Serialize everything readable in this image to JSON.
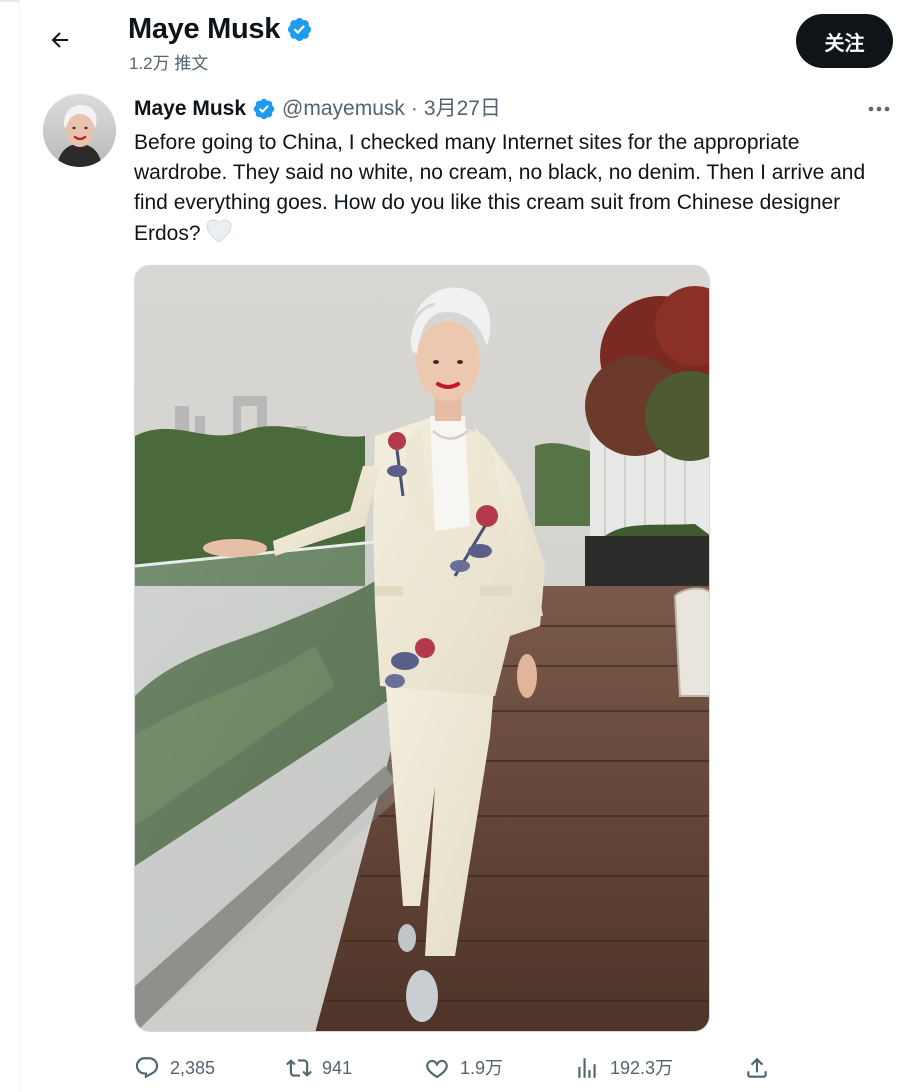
{
  "header": {
    "title": "Maye Musk",
    "subtitle": "1.2万 推文",
    "follow_label": "关注"
  },
  "tweet": {
    "author_name": "Maye Musk",
    "handle": "@mayemusk",
    "separator": "·",
    "date": "3月27日",
    "text": "Before going to China, I checked many Internet sites for the appropriate wardrobe. They said no white, no cream, no black, no denim. Then I arrive and find everything goes. How do you like this cream suit from Chinese designer Erdos?",
    "emoji": "white-heart",
    "media_description_icon": "photo"
  },
  "actions": {
    "replies": "2,385",
    "retweets": "941",
    "likes": "1.9万",
    "views": "192.3万"
  },
  "colors": {
    "verified": "#1d9bf0",
    "follow_bg": "#0f1419",
    "muted_text": "#536471",
    "border": "#cfd9de"
  },
  "icons": {
    "back": "arrow-left-icon",
    "verified": "verified-badge-icon",
    "more": "more-horizontal-icon",
    "reply": "reply-icon",
    "retweet": "retweet-icon",
    "like": "heart-icon",
    "views": "views-chart-icon",
    "share": "share-icon"
  }
}
